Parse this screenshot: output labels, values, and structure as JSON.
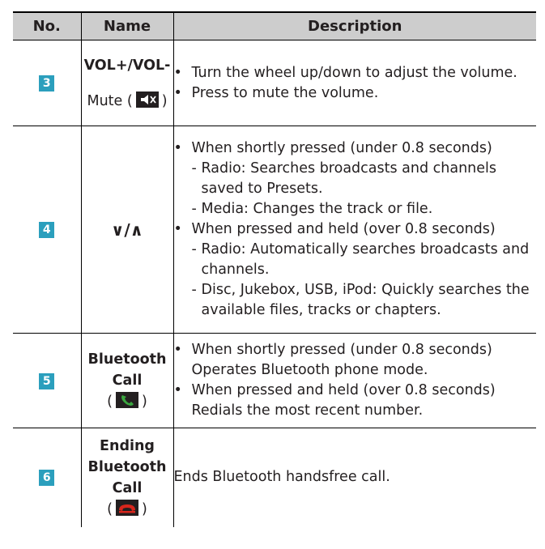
{
  "header": {
    "no": "No.",
    "name": "Name",
    "description": "Description"
  },
  "rows": [
    {
      "no": "3",
      "name_line1": "VOL+/VOL-",
      "name_line2": "Mute (",
      "name_line2_end": ")",
      "icon": "mute-speaker-icon",
      "bullet1": "Turn the wheel up/down to adjust the volume.",
      "bullet2": "Press to mute the volume."
    },
    {
      "no": "4",
      "name": "∨/∧",
      "bullet1": "When shortly pressed (under 0.8 seconds)",
      "sub1": "Radio: Searches broadcasts and channels saved to Presets.",
      "sub2": "Media: Changes the track or file.",
      "bullet2": "When pressed and held (over 0.8 seconds)",
      "sub3": "Radio: Automatically searches broadcasts and channels.",
      "sub4": "Disc, Jukebox, USB, iPod: Quickly searches the available files, tracks or chapters."
    },
    {
      "no": "5",
      "name_line1": "Bluetooth",
      "name_line2": "Call",
      "paren_open": "(",
      "paren_close": ")",
      "icon": "green-phone-icon",
      "bullet1": "When shortly pressed (under 0.8 seconds)",
      "bullet1_cont": "Operates Bluetooth phone mode.",
      "bullet2": "When pressed and held (over 0.8 seconds)",
      "bullet2_cont": "Redials the most recent number."
    },
    {
      "no": "6",
      "name_line1": "Ending",
      "name_line2": "Bluetooth",
      "name_line3": "Call",
      "paren_open": "(",
      "paren_close": ")",
      "icon": "red-phone-icon",
      "description": "Ends Bluetooth handsfree call."
    }
  ],
  "bullet_char": "•",
  "dash_char": "-",
  "colors": {
    "header_bg": "#cdcdcd",
    "badge_bg": "#2b9fbd",
    "green_icon": "#3aa63f",
    "red_icon": "#d8261c"
  }
}
